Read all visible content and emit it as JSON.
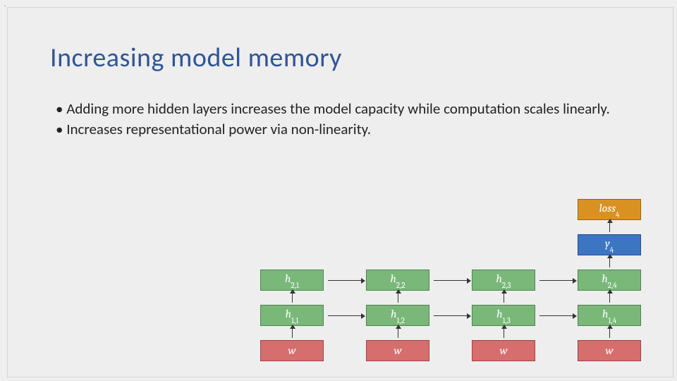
{
  "title": "Increasing model memory",
  "bullets": [
    "Adding more hidden layers increases the model capacity while computation scales linearly.",
    "Increases representational power via non-linearity."
  ],
  "diagram": {
    "loss": {
      "label": "loss",
      "sub": "4",
      "color": "orange"
    },
    "y": {
      "label": "y",
      "sub": "4",
      "color": "blue"
    },
    "h2": [
      {
        "label": "h",
        "sub": "2,1"
      },
      {
        "label": "h",
        "sub": "2,2"
      },
      {
        "label": "h",
        "sub": "2,3"
      },
      {
        "label": "h",
        "sub": "2,4"
      }
    ],
    "h1": [
      {
        "label": "h",
        "sub": "1,1"
      },
      {
        "label": "h",
        "sub": "1,2"
      },
      {
        "label": "h",
        "sub": "1,3"
      },
      {
        "label": "h",
        "sub": "1,4"
      }
    ],
    "w": [
      {
        "label": "w"
      },
      {
        "label": "w"
      },
      {
        "label": "w"
      },
      {
        "label": "w"
      }
    ]
  }
}
